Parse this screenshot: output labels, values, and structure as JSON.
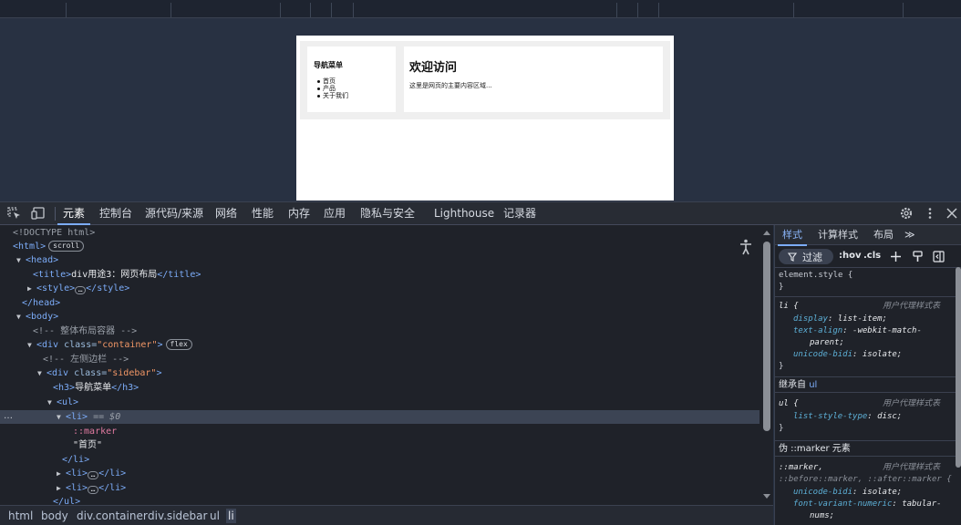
{
  "preview": {
    "sidebar_heading": "导航菜单",
    "sidebar_items": [
      "首页",
      "产品",
      "关于我们"
    ],
    "main_heading": "欢迎访问",
    "main_text": "这里是网页的主要内容区域..."
  },
  "devtools": {
    "tabs": [
      "元素",
      "控制台",
      "源代码/来源",
      "网络",
      "性能",
      "内存",
      "应用",
      "隐私与安全",
      "Lighthouse",
      "记录器"
    ],
    "active_tab": "元素"
  },
  "dom_tree": {
    "doctype": "<!DOCTYPE html>",
    "html_open": "<html>",
    "scroll_badge": "scroll",
    "head_open": "<head>",
    "title_open": "<title>",
    "title_text": "div用途3：网页布局",
    "title_close": "</title>",
    "style_open": "<style>",
    "style_close": "</style>",
    "head_close": "</head>",
    "body_open": "<body>",
    "comment_container": "<!-- 整体布局容器 -->",
    "div_tag": "<div",
    "attr_class": "class=",
    "container_val": "\"container\"",
    "gt": ">",
    "flex_badge": "flex",
    "comment_sidebar": "<!-- 左侧边栏 -->",
    "sidebar_val": "\"sidebar\"",
    "h3_open": "<h3>",
    "h3_text": "导航菜单",
    "h3_close": "</h3>",
    "ul_open": "<ul>",
    "li_open": "<li>",
    "selected_suffix": " == $0",
    "marker": "::marker",
    "li_text": "\"首页\"",
    "li_close": "</li>",
    "ul_close": "</ul>",
    "row_dots": "…"
  },
  "breadcrumbs": [
    "html",
    "body",
    "div.container",
    "div.sidebar",
    "ul",
    "li"
  ],
  "styles_pane": {
    "tabs": [
      "样式",
      "计算样式",
      "布局"
    ],
    "more": "≫",
    "filter_label": "过滤",
    "hov": ":hov",
    "cls": ".cls",
    "element_style": "element.style {",
    "close_brace": "}",
    "li_selector": "li {",
    "ua_label": "用户代理样式表",
    "li_props": [
      {
        "prop": "display",
        "val": "list-item;"
      },
      {
        "prop": "text-align",
        "val": "-webkit-match-"
      },
      {
        "prop": "",
        "val": "parent;"
      },
      {
        "prop": "unicode-bidi",
        "val": "isolate;"
      }
    ],
    "inherited_label": "继承自",
    "inherited_from": "ul",
    "ul_selector": "ul {",
    "ul_props": [
      {
        "prop": "list-style-type",
        "val": "disc;"
      }
    ],
    "pseudo_header": "伪 ::marker 元素",
    "marker_selector": "::marker,",
    "marker_selector2": "::before::marker, ::after::marker {",
    "marker_props": [
      {
        "prop": "unicode-bidi",
        "val": "isolate;"
      },
      {
        "prop": "font-variant-numeric",
        "val": "tabular-"
      },
      {
        "prop": "",
        "val": "nums;"
      }
    ]
  },
  "colors": {
    "accent": "#7cacf8",
    "tag": "#7cacf8",
    "attr_value": "#f29766",
    "panel_bg": "#1f2229"
  }
}
